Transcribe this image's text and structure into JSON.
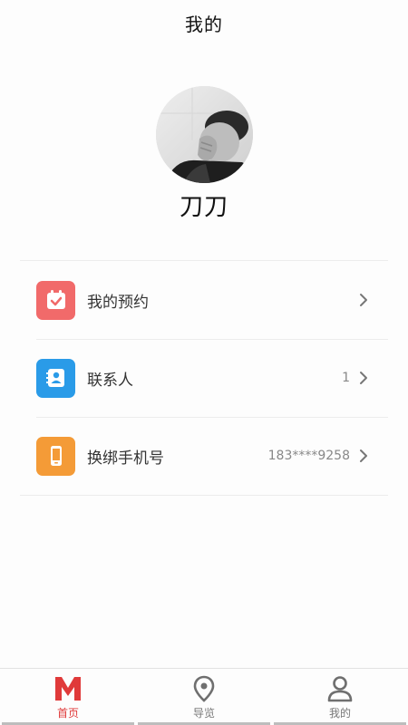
{
  "header": {
    "title": "我的"
  },
  "profile": {
    "username": "刀刀"
  },
  "menu": {
    "items": [
      {
        "label": "我的预约",
        "value": "",
        "icon": "calendar-check-icon",
        "icon_color": "#f16a6a"
      },
      {
        "label": "联系人",
        "value": "1",
        "icon": "contact-card-icon",
        "icon_color": "#2a9be8"
      },
      {
        "label": "换绑手机号",
        "value": "183****9258",
        "icon": "phone-icon",
        "icon_color": "#f49b37"
      }
    ]
  },
  "bottom_nav": {
    "items": [
      {
        "label": "首页",
        "icon": "home-m-logo-icon",
        "active": true
      },
      {
        "label": "导览",
        "icon": "location-pin-icon",
        "active": false
      },
      {
        "label": "我的",
        "icon": "person-icon",
        "active": false
      }
    ],
    "active_color": "#e03a3a"
  }
}
